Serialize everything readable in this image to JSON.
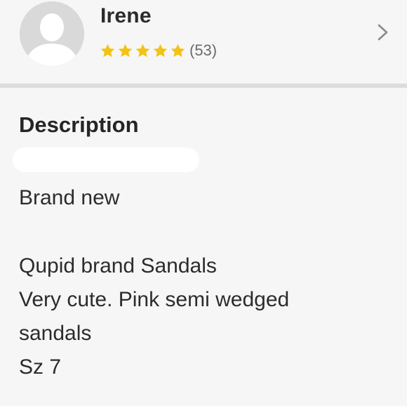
{
  "seller": {
    "name": "Irene",
    "rating_stars": 5,
    "rating_count": "(53)",
    "star_color": "#f3c314"
  },
  "icons": {
    "avatar": "default-user-avatar-icon",
    "star": "star-icon",
    "chevron": "chevron-right-icon"
  },
  "description": {
    "title": "Description",
    "lines": [
      "Brand new",
      "Qupid brand Sandals",
      "Very cute. Pink semi wedged",
      "sandals",
      "Sz 7"
    ]
  }
}
